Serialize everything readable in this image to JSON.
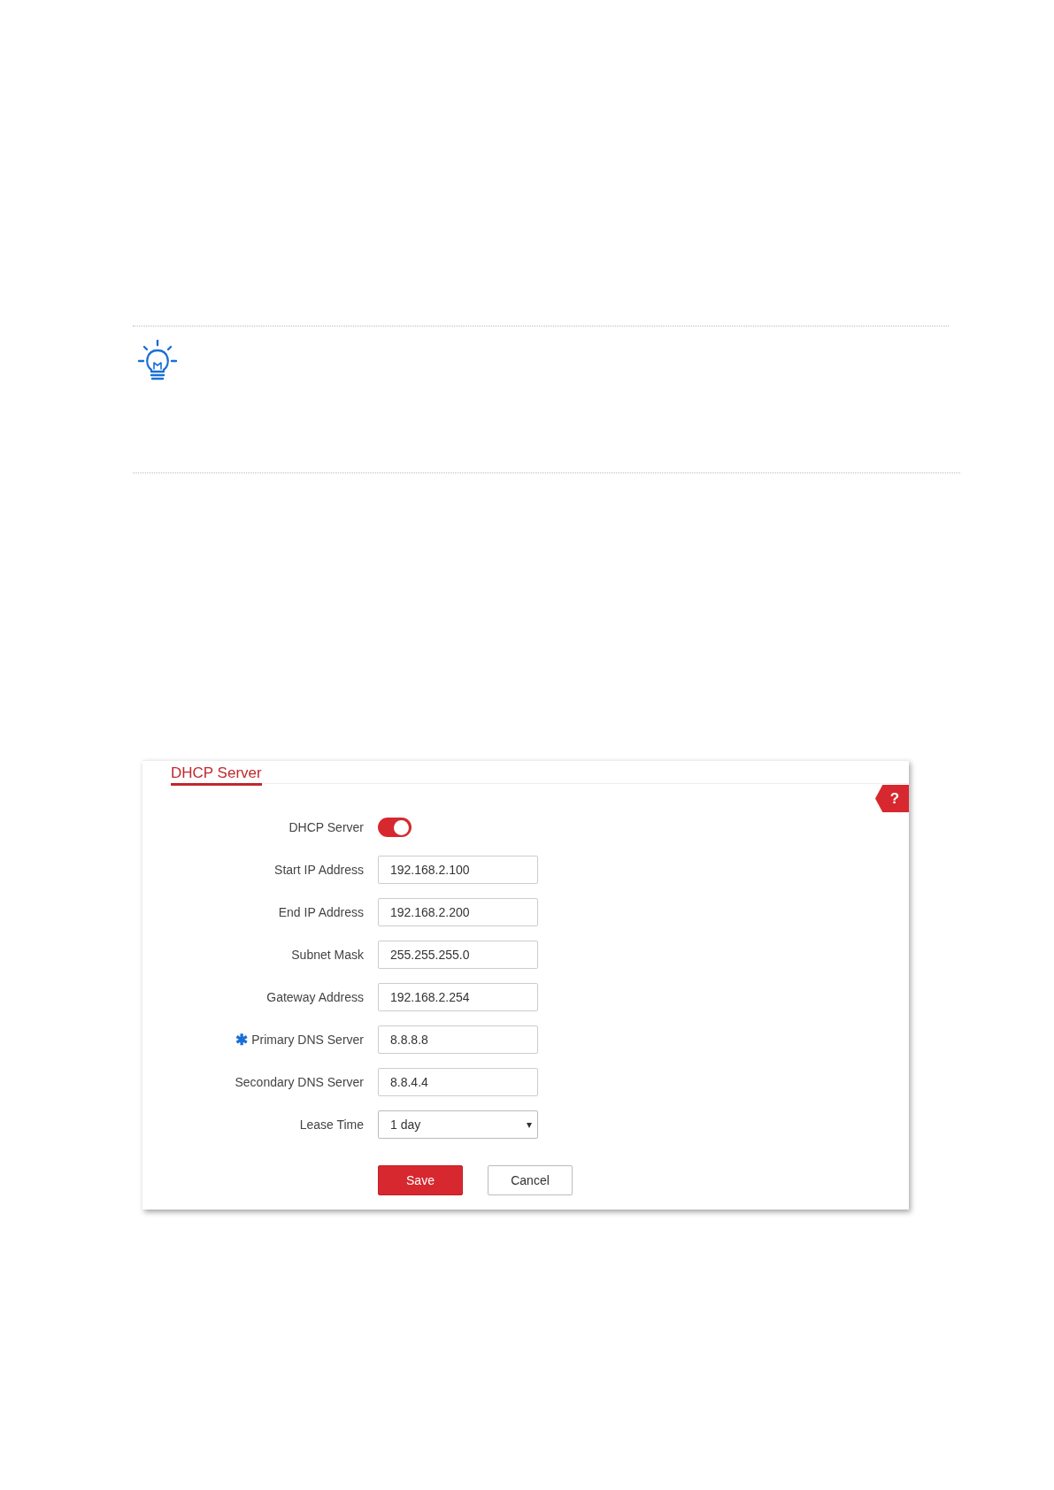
{
  "panel": {
    "title": "DHCP Server",
    "help": "?"
  },
  "fields": [
    {
      "kind": "toggle",
      "label": "DHCP Server",
      "on": true
    },
    {
      "kind": "text",
      "label": "Start IP Address",
      "value": "192.168.2.100"
    },
    {
      "kind": "text",
      "label": "End IP Address",
      "value": "192.168.2.200"
    },
    {
      "kind": "text",
      "label": "Subnet Mask",
      "value": "255.255.255.0"
    },
    {
      "kind": "text",
      "label": "Gateway Address",
      "value": "192.168.2.254"
    },
    {
      "kind": "text",
      "label": "Primary DNS Server",
      "value": "8.8.8.8",
      "required_mark": "✱"
    },
    {
      "kind": "text",
      "label": "Secondary DNS Server",
      "value": "8.8.4.4"
    },
    {
      "kind": "select",
      "label": "Lease Time",
      "value": "1 day",
      "caret": "▾"
    }
  ],
  "buttons": [
    {
      "label": "Save",
      "kind": "primary"
    },
    {
      "label": "Cancel",
      "kind": "secondary"
    }
  ]
}
